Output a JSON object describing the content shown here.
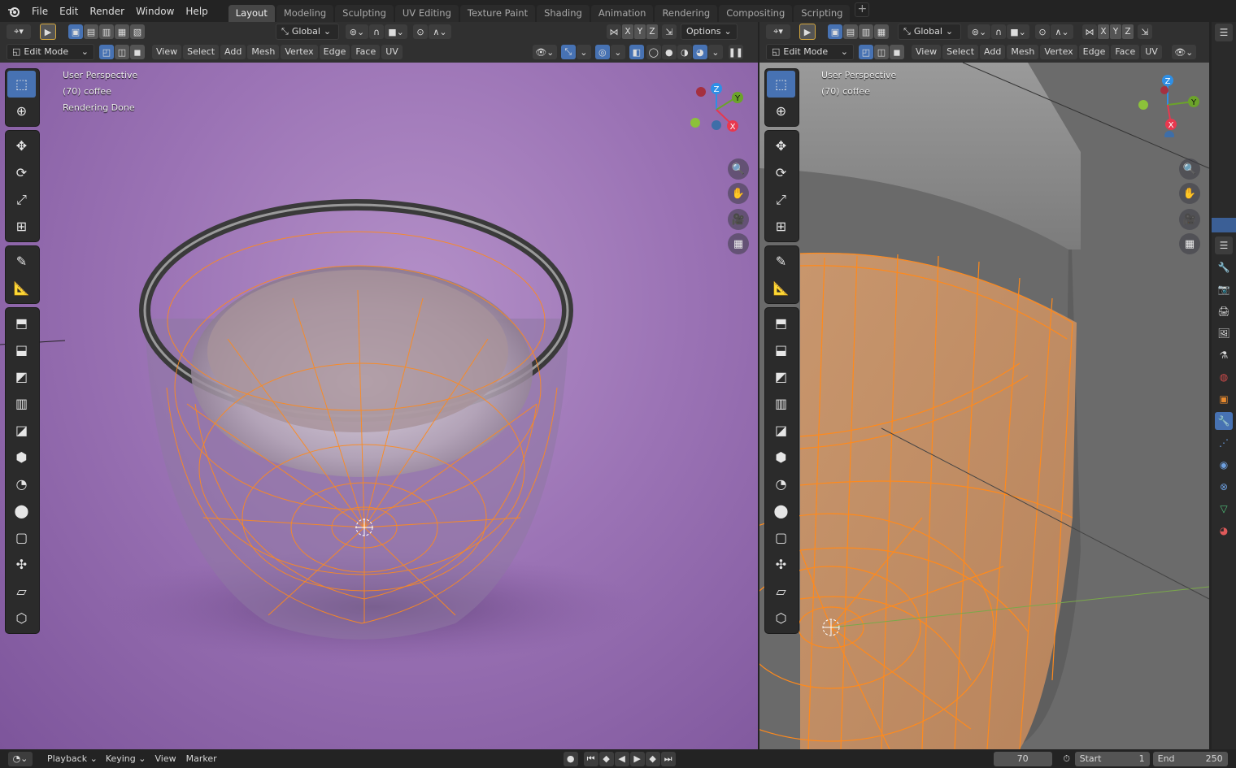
{
  "app": {
    "logo_icon": "blender-logo-icon"
  },
  "menu": [
    "File",
    "Edit",
    "Render",
    "Window",
    "Help"
  ],
  "workspace_tabs": [
    {
      "label": "Layout",
      "active": true
    },
    {
      "label": "Modeling"
    },
    {
      "label": "Sculpting"
    },
    {
      "label": "UV Editing"
    },
    {
      "label": "Texture Paint"
    },
    {
      "label": "Shading"
    },
    {
      "label": "Animation"
    },
    {
      "label": "Rendering"
    },
    {
      "label": "Compositing"
    },
    {
      "label": "Scripting"
    }
  ],
  "left_view": {
    "transform_orientation": "Global",
    "options_label": "Options",
    "mode": "Edit Mode",
    "header_menus": [
      "View",
      "Select",
      "Add",
      "Mesh",
      "Vertex",
      "Edge",
      "Face",
      "UV"
    ],
    "axes": [
      "X",
      "Y",
      "Z"
    ],
    "overlay_lines": [
      "User Perspective",
      "(70) coffee",
      "Rendering Done"
    ],
    "background": "#9a74b4"
  },
  "right_view": {
    "transform_orientation": "Global",
    "mode": "Edit Mode",
    "header_menus": [
      "View",
      "Select",
      "Add",
      "Mesh",
      "Vertex",
      "Edge",
      "Face",
      "UV"
    ],
    "axes": [
      "X",
      "Y",
      "Z"
    ],
    "overlay_lines": [
      "User Perspective",
      "(70) coffee"
    ],
    "background": "#6b6b6b"
  },
  "gizmo_labels": {
    "z": "Z",
    "y": "Y",
    "x": "X"
  },
  "tools": [
    "select-box-icon",
    "cursor-icon",
    "move-icon",
    "rotate-icon",
    "scale-icon",
    "transform-icon",
    "annotate-icon",
    "measure-icon",
    "extrude-region-icon",
    "inset-faces-icon",
    "bevel-icon",
    "loop-cut-icon",
    "knife-icon",
    "poly-build-icon",
    "spin-icon",
    "smooth-icon",
    "edge-slide-icon",
    "shrink-fatten-icon",
    "shear-icon",
    "rip-region-icon"
  ],
  "statusbar": {
    "playback": "Playback",
    "keying": "Keying",
    "view": "View",
    "marker": "Marker",
    "current_frame": "70",
    "start_label": "Start",
    "start_value": "1",
    "end_label": "End",
    "end_value": "250"
  },
  "colors": {
    "accent": "#4772b3",
    "mesh_wire": "#ff8a1c",
    "gizmo_x": "#e8384f",
    "gizmo_y": "#6ba32a",
    "gizmo_z": "#2e8fe6"
  }
}
